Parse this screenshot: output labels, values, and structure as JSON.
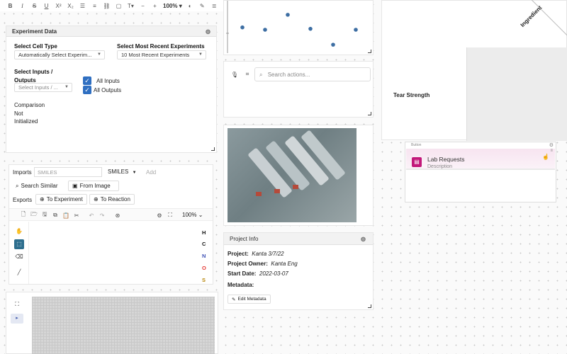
{
  "toolbar": {
    "zoom": "100%",
    "font": "Arial",
    "icons": [
      "bold-icon",
      "italic-icon",
      "strikethrough-icon",
      "underline-icon",
      "superscript-icon",
      "subscript-icon",
      "bullet-list-icon",
      "numbered-list-icon",
      "link-icon",
      "shapes-icon",
      "text-size-icon",
      "minus-icon",
      "plus-icon"
    ]
  },
  "experiment_panel": {
    "title": "Experiment Data",
    "cell_type_label": "Select Cell Type",
    "cell_type_value": "Automatically Select Experim...",
    "recent_label": "Select Most Recent Experiments",
    "recent_value": "10 Most Recent Experiments",
    "inputs_outputs_label_1": "Select Inputs /",
    "inputs_outputs_label_2": "Outputs",
    "inputs_outputs_placeholder": "Select Inputs / ...",
    "all_inputs": "All Inputs",
    "all_outputs": "All Outputs",
    "comparison_1": "Comparison",
    "comparison_2": "Not",
    "comparison_3": "Initialized"
  },
  "chem_panel": {
    "imports_label": "Imports",
    "smiles_placeholder": "SMILES",
    "format_value": "SMILES",
    "add_label": "Add",
    "search_similar": "Search Similar",
    "from_image": "From Image",
    "exports_label": "Exports",
    "to_experiment": "To Experiment",
    "to_reaction": "To Reaction",
    "zoom": "100%",
    "atoms": [
      "H",
      "C",
      "N",
      "O",
      "S"
    ],
    "atom_colors": [
      "#111111",
      "#111111",
      "#3f51b5",
      "#e53935",
      "#b8860b"
    ]
  },
  "actions_panel": {
    "search_placeholder": "Search actions..."
  },
  "project_info": {
    "title": "Project Info",
    "project_label": "Project:",
    "project_value": "Kanta 3/7/22",
    "owner_label": "Project Owner:",
    "owner_value": "Kanta Eng",
    "start_label": "Start Date:",
    "start_value": "2022-03-07",
    "metadata_label": "Metadata:",
    "edit_metadata": "Edit Metadata"
  },
  "chart_data": {
    "type": "scatter",
    "x": [
      1,
      2,
      3,
      4,
      5,
      6
    ],
    "y": [
      0.55,
      0.5,
      0.82,
      0.52,
      0.18,
      0.5
    ],
    "xlim": [
      0.5,
      6.5
    ],
    "ylim": [
      0,
      1
    ],
    "color": "#3d6ea3"
  },
  "table_panel": {
    "tear_strength": "Tear Strength",
    "ingredient_header": "Ingredient"
  },
  "button_card": {
    "tag": "Button",
    "title": "Lab Requests",
    "description": "Description",
    "accent": "#c2187a"
  }
}
